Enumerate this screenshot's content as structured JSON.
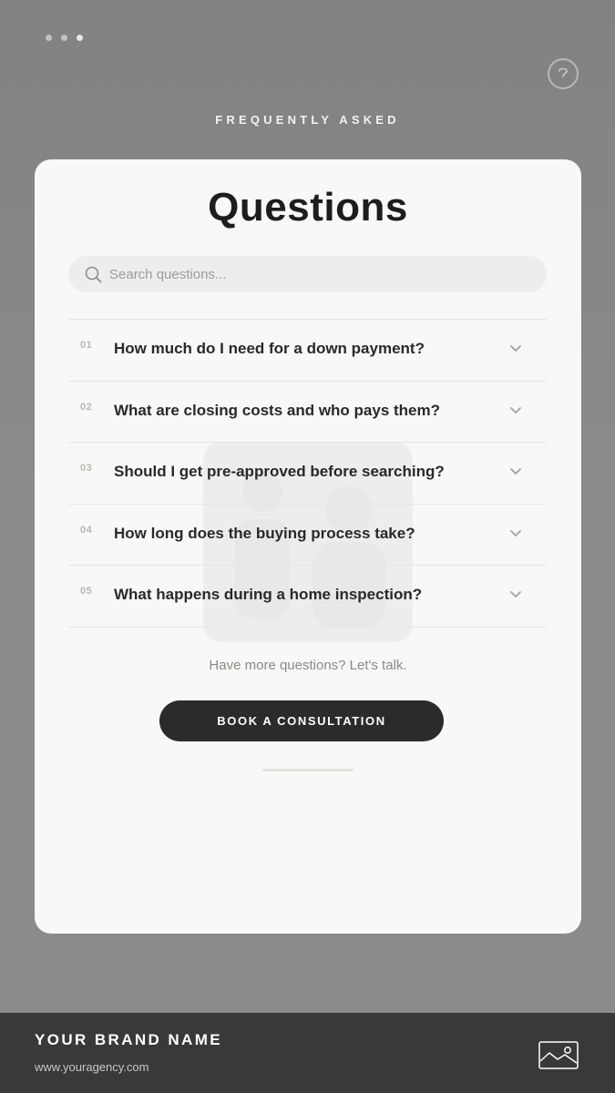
{
  "header": {
    "page_dots": 3,
    "active_dot": 3,
    "eyebrow": "FREQUENTLY ASKED",
    "help_icon": "help-circle-icon"
  },
  "card": {
    "title": "Questions",
    "search": {
      "placeholder": "Search questions...",
      "value": ""
    },
    "faqs": [
      {
        "num": "01",
        "question": "How much do I need for a down payment?"
      },
      {
        "num": "02",
        "question": "What are closing costs and who pays them?"
      },
      {
        "num": "03",
        "question": "Should I get pre-approved before searching?"
      },
      {
        "num": "04",
        "question": "How long does the buying process take?"
      },
      {
        "num": "05",
        "question": "What happens during a home inspection?"
      }
    ],
    "more_text": "Have more questions? Let's talk.",
    "cta_label": "BOOK A CONSULTATION"
  },
  "footer": {
    "brand": "YOUR BRAND NAME",
    "url": "www.youragency.com",
    "logo_icon": "image-placeholder-icon"
  },
  "colors": {
    "background": "#8a898b",
    "card": "#f9f8f6",
    "cta": "#2c2b2b",
    "footer": "#3a3939"
  }
}
